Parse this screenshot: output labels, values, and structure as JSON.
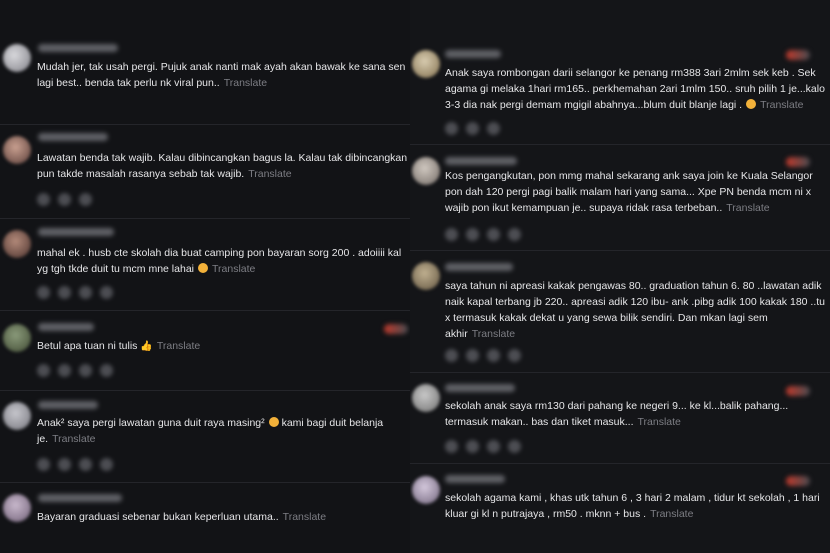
{
  "left_comments": [
    {
      "text": "Mudah jer, tak usah pergi. Pujuk anak nanti mak ayah akan bawak ke sana sen lagi best.. benda tak perlu nk viral pun..",
      "translate": "Translate"
    },
    {
      "text": "Lawatan benda tak wajib. Kalau dibincangkan bagus la. Kalau tak dibincangkan pun takde masalah rasanya sebab tak wajib.",
      "translate": "Translate"
    },
    {
      "text": "mahal ek . husb cte skolah dia buat camping pon bayaran sorg 200 . adoiiii kal yg tgh tkde duit tu mcm mne lahai",
      "emoji": "face-icon",
      "translate": "Translate"
    },
    {
      "text": "Betul apa tuan ni tulis",
      "emoji": "👍",
      "translate": "Translate"
    },
    {
      "text": "Anak² saya pergi lawatan guna duit raya masing²",
      "text2": "kami bagi duit belanja je.",
      "emoji": "face-icon",
      "translate": "Translate"
    },
    {
      "text": "Bayaran graduasi sebenar bukan keperluan utama..",
      "translate": "Translate"
    }
  ],
  "right_comments": [
    {
      "text": "Anak saya rombongan darii selangor ke penang rm388 3ari 2mlm sek keb . Sek agama gi melaka 1hari rm165.. perkhemahan 2ari 1mlm 150.. sruh pilih 1 je...kalo 3-3 dia nak pergi demam mgigil abahnya...blum duit blanje lagi .",
      "emoji": "face-icon",
      "translate": "Translate"
    },
    {
      "text": "Kos pengangkutan, pon mmg mahal sekarang ank saya join ke Kuala Selangor pon dah 120 pergi pagi balik malam hari yang sama... Xpe PN benda mcm ni x wajib pon ikut kemampuan je.. supaya ridak rasa terbeban..",
      "translate": "Translate"
    },
    {
      "text": "saya tahun ni apreasi kakak pengawas 80.. graduation tahun 6. 80 ..lawatan adik naik kapal terbang jb 220.. apreasi adik 120 ibu- ank .pibg adik 100 kakak 180 ..tu x termasuk kakak dekat u yang sewa bilik sendiri. Dan mkan lagi sem akhir",
      "translate": "Translate"
    },
    {
      "text": "sekolah anak saya rm130 dari pahang ke negeri 9... ke kl...balik pahang... termasuk makan.. bas dan tiket masuk...",
      "translate": "Translate"
    },
    {
      "text": "sekolah agama kami , khas utk tahun 6 , 3 hari 2 malam , tidur kt sekolah , 1 hari kluar gi kl n putrajaya , rm50 . mknn + bus .",
      "translate": "Translate"
    }
  ]
}
